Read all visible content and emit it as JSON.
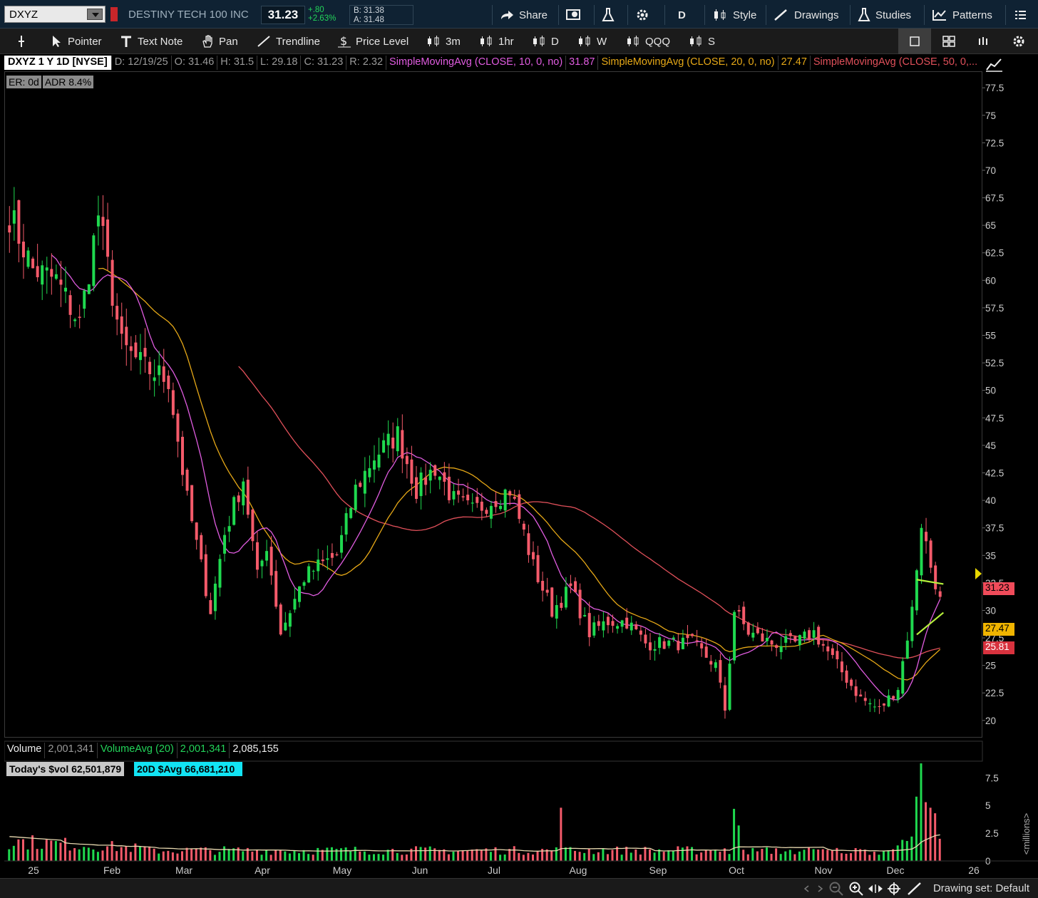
{
  "topbar": {
    "symbol": "DXYZ",
    "company": "DESTINY TECH 100 INC",
    "last": "31.23",
    "change": "+.80",
    "change_pct": "+2.63%",
    "bid": "B: 31.38",
    "ask": "A: 31.48",
    "buttons": [
      "Share",
      "D",
      "Style",
      "Drawings",
      "Studies",
      "Patterns"
    ]
  },
  "toolbar": {
    "items": [
      "Pointer",
      "Text Note",
      "Pan",
      "Trendline",
      "Price Level",
      "3m",
      "1hr",
      "D",
      "W",
      "QQQ",
      "S"
    ]
  },
  "header": {
    "ticker": "DXYZ 1 Y 1D [NYSE]",
    "date": "D: 12/19/25",
    "open": "O: 31.46",
    "high": "H: 31.5",
    "low": "L: 29.18",
    "close": "C: 31.23",
    "range": "R: 2.32",
    "sma10_label": "SimpleMovingAvg (CLOSE, 10, 0, no)",
    "sma10_value": "31.87",
    "sma20_label": "SimpleMovingAvg (CLOSE, 20, 0, no)",
    "sma20_value": "27.47",
    "sma50_label": "SimpleMovingAvg (CLOSE, 50, 0,..."
  },
  "badges": {
    "er": "ER: 0d",
    "adr": "ADR 8.4%"
  },
  "volume_header": {
    "label": "Volume",
    "value": "2,001,341",
    "avg_label": "VolumeAvg (20)",
    "avg_value": "2,001,341",
    "extra": "2,085,155",
    "todays": "Today's $vol 62,501,879",
    "avg20": "20D $Avg 66,681,210"
  },
  "price_labels": {
    "last": "31.23",
    "sma20": "27.47",
    "sma50": "25.81"
  },
  "bottom": {
    "drawing_set": "Drawing set: Default"
  },
  "colors": {
    "up": "#1fd94f",
    "down": "#f45a6a",
    "sma10": "#e05ce0",
    "sma20": "#e6a817",
    "sma50": "#e0505a",
    "trendline": "#b6f03c",
    "volavg": "#e8d9b0"
  },
  "chart_data": {
    "type": "candlestick",
    "title": "DXYZ 1 Y 1D [NYSE]",
    "ylim": [
      18.5,
      79
    ],
    "y_ticks": [
      "77.5",
      "75",
      "72.5",
      "70",
      "67.5",
      "65",
      "62.5",
      "60",
      "57.5",
      "55",
      "52.5",
      "50",
      "47.5",
      "45",
      "42.5",
      "40",
      "37.5",
      "35",
      "32.5",
      "30",
      "27.5",
      "25",
      "22.5",
      "20"
    ],
    "x_ticks": [
      "25",
      "Feb",
      "Mar",
      "Apr",
      "May",
      "Jun",
      "Jul",
      "Aug",
      "Sep",
      "Oct",
      "Nov",
      "Dec",
      "26"
    ],
    "volume_ylim_millions": [
      0,
      9
    ],
    "volume_ticks": [
      "7.5",
      "5",
      "2.5",
      "0"
    ],
    "volume_unit_label": "<millions>",
    "close_keyframes": [
      [
        0,
        66
      ],
      [
        5,
        61
      ],
      [
        10,
        60
      ],
      [
        15,
        56
      ],
      [
        19,
        66
      ],
      [
        24,
        54
      ],
      [
        29,
        52
      ],
      [
        34,
        51
      ],
      [
        38,
        40
      ],
      [
        43,
        30
      ],
      [
        46,
        37
      ],
      [
        50,
        42
      ],
      [
        53,
        33
      ],
      [
        55,
        36
      ],
      [
        58,
        28
      ],
      [
        63,
        33
      ],
      [
        66,
        34
      ],
      [
        70,
        35
      ],
      [
        74,
        41
      ],
      [
        78,
        44
      ],
      [
        83,
        46
      ],
      [
        87,
        41
      ],
      [
        91,
        43
      ],
      [
        95,
        40
      ],
      [
        99,
        39
      ],
      [
        103,
        40
      ],
      [
        107,
        41
      ],
      [
        110,
        37
      ],
      [
        112,
        34
      ],
      [
        116,
        30
      ],
      [
        120,
        32
      ],
      [
        124,
        28
      ],
      [
        128,
        29
      ],
      [
        132,
        29
      ],
      [
        136,
        27
      ],
      [
        142,
        27
      ],
      [
        146,
        27
      ],
      [
        151,
        25
      ],
      [
        153,
        21
      ],
      [
        155,
        30
      ],
      [
        158,
        28
      ],
      [
        163,
        27
      ],
      [
        168,
        27
      ],
      [
        172,
        28
      ],
      [
        177,
        25
      ],
      [
        182,
        22
      ],
      [
        186,
        21
      ],
      [
        190,
        23
      ],
      [
        193,
        30
      ],
      [
        195,
        38
      ],
      [
        197,
        34
      ],
      [
        199,
        31.23
      ]
    ],
    "sma10_last": 31.87,
    "sma20_last": 27.47,
    "sma50_last": 25.81,
    "volume_millions_avg20_last": 2.085155,
    "volume_last": 2001341,
    "trendlines": [
      {
        "from": [
          194,
          32.8
        ],
        "to": [
          199.7,
          32.4
        ]
      },
      {
        "from": [
          194,
          27.8
        ],
        "to": [
          199.7,
          29.8
        ]
      }
    ]
  }
}
